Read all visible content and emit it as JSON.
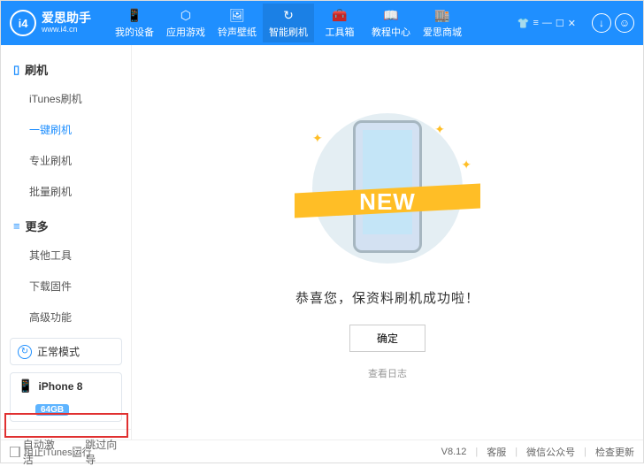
{
  "header": {
    "logo_text": "i4",
    "title": "爱思助手",
    "url": "www.i4.cn",
    "nav": [
      {
        "label": "我的设备"
      },
      {
        "label": "应用游戏"
      },
      {
        "label": "铃声壁纸"
      },
      {
        "label": "智能刷机"
      },
      {
        "label": "工具箱"
      },
      {
        "label": "教程中心"
      },
      {
        "label": "爱思商城"
      }
    ]
  },
  "sidebar": {
    "sec1_title": "刷机",
    "sec1": [
      {
        "label": "iTunes刷机"
      },
      {
        "label": "一键刷机"
      },
      {
        "label": "专业刷机"
      },
      {
        "label": "批量刷机"
      }
    ],
    "sec2_title": "更多",
    "sec2": [
      {
        "label": "其他工具"
      },
      {
        "label": "下载固件"
      },
      {
        "label": "高级功能"
      }
    ],
    "status": "正常模式",
    "device": "iPhone 8",
    "badge": "64GB",
    "cb1": "自动激活",
    "cb2": "跳过向导"
  },
  "main": {
    "ribbon": "NEW",
    "message": "恭喜您，保资料刷机成功啦！",
    "ok": "确定",
    "view_log": "查看日志"
  },
  "footer": {
    "cb": "阻止iTunes运行",
    "version": "V8.12",
    "svc": "客服",
    "wechat": "微信公众号",
    "update": "检查更新"
  }
}
